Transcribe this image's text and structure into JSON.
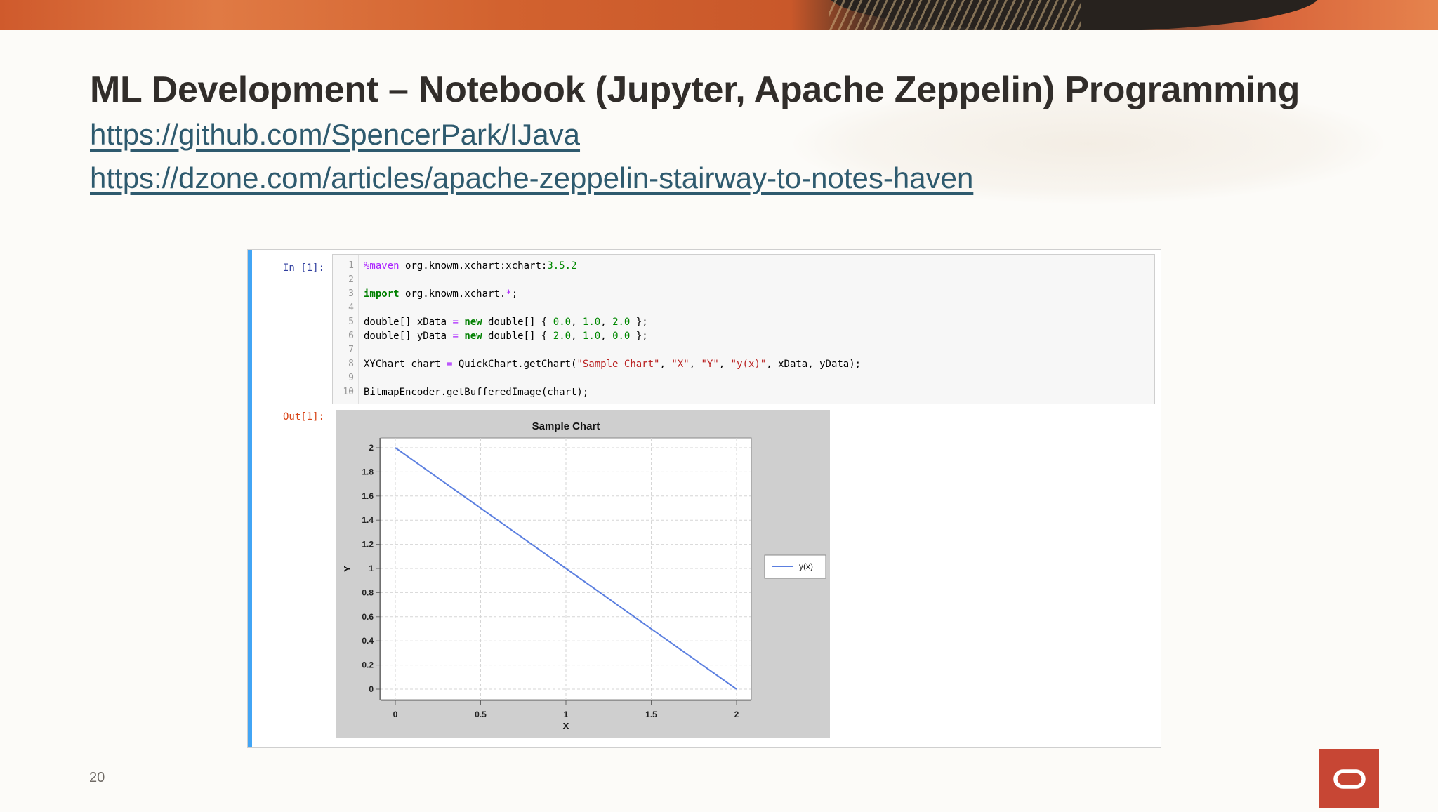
{
  "slide": {
    "title": "ML Development – Notebook (Jupyter, Apache Zeppelin) Programming",
    "links": [
      "https://github.com/SpencerPark/IJava",
      "https://dzone.com/articles/apache-zeppelin-stairway-to-notes-haven"
    ],
    "page_number": "20",
    "logo": "oracle-logo"
  },
  "notebook": {
    "in_prompt": "In [1]:",
    "out_prompt": "Out[1]:",
    "code_lines": [
      {
        "n": "1",
        "parts": [
          {
            "t": "%maven",
            "c": "magic"
          },
          {
            "t": " org.knowm.xchart:xchart:",
            "c": ""
          },
          {
            "t": "3.5.2",
            "c": "num"
          }
        ]
      },
      {
        "n": "2",
        "parts": []
      },
      {
        "n": "3",
        "parts": [
          {
            "t": "import",
            "c": "kw"
          },
          {
            "t": " org.knowm.xchart.",
            "c": ""
          },
          {
            "t": "*",
            "c": "op"
          },
          {
            "t": ";",
            "c": ""
          }
        ]
      },
      {
        "n": "4",
        "parts": []
      },
      {
        "n": "5",
        "parts": [
          {
            "t": "double[] xData ",
            "c": ""
          },
          {
            "t": "=",
            "c": "op"
          },
          {
            "t": " ",
            "c": ""
          },
          {
            "t": "new",
            "c": "kw"
          },
          {
            "t": " double[] { ",
            "c": ""
          },
          {
            "t": "0.0",
            "c": "num"
          },
          {
            "t": ", ",
            "c": ""
          },
          {
            "t": "1.0",
            "c": "num"
          },
          {
            "t": ", ",
            "c": ""
          },
          {
            "t": "2.0",
            "c": "num"
          },
          {
            "t": " };",
            "c": ""
          }
        ]
      },
      {
        "n": "6",
        "parts": [
          {
            "t": "double[] yData ",
            "c": ""
          },
          {
            "t": "=",
            "c": "op"
          },
          {
            "t": " ",
            "c": ""
          },
          {
            "t": "new",
            "c": "kw"
          },
          {
            "t": " double[] { ",
            "c": ""
          },
          {
            "t": "2.0",
            "c": "num"
          },
          {
            "t": ", ",
            "c": ""
          },
          {
            "t": "1.0",
            "c": "num"
          },
          {
            "t": ", ",
            "c": ""
          },
          {
            "t": "0.0",
            "c": "num"
          },
          {
            "t": " };",
            "c": ""
          }
        ]
      },
      {
        "n": "7",
        "parts": []
      },
      {
        "n": "8",
        "parts": [
          {
            "t": "XYChart chart ",
            "c": ""
          },
          {
            "t": "=",
            "c": "op"
          },
          {
            "t": " QuickChart.getChart(",
            "c": ""
          },
          {
            "t": "\"Sample Chart\"",
            "c": "str"
          },
          {
            "t": ", ",
            "c": ""
          },
          {
            "t": "\"X\"",
            "c": "str"
          },
          {
            "t": ", ",
            "c": ""
          },
          {
            "t": "\"Y\"",
            "c": "str"
          },
          {
            "t": ", ",
            "c": ""
          },
          {
            "t": "\"y(x)\"",
            "c": "str"
          },
          {
            "t": ", xData, yData);",
            "c": ""
          }
        ]
      },
      {
        "n": "9",
        "parts": []
      },
      {
        "n": "10",
        "parts": [
          {
            "t": "BitmapEncoder.getBufferedImage(chart);",
            "c": ""
          }
        ]
      }
    ]
  },
  "colors": {
    "accent_bar": "#42a5f5",
    "series_line": "#5b7fe0",
    "chart_background": "#cfcfcf",
    "logo_red": "#c74634"
  },
  "chart_data": {
    "type": "line",
    "title": "Sample Chart",
    "xlabel": "X",
    "ylabel": "Y",
    "x": [
      0.0,
      1.0,
      2.0
    ],
    "series": [
      {
        "name": "y(x)",
        "values": [
          2.0,
          1.0,
          0.0
        ]
      }
    ],
    "xlim": [
      0,
      2
    ],
    "ylim": [
      0,
      2
    ],
    "x_ticks": [
      "0",
      "0.5",
      "1",
      "1.5",
      "2"
    ],
    "y_ticks": [
      "0",
      "0.2",
      "0.4",
      "0.6",
      "0.8",
      "1",
      "1.2",
      "1.4",
      "1.6",
      "1.8",
      "2"
    ],
    "grid": true,
    "legend": "right"
  }
}
